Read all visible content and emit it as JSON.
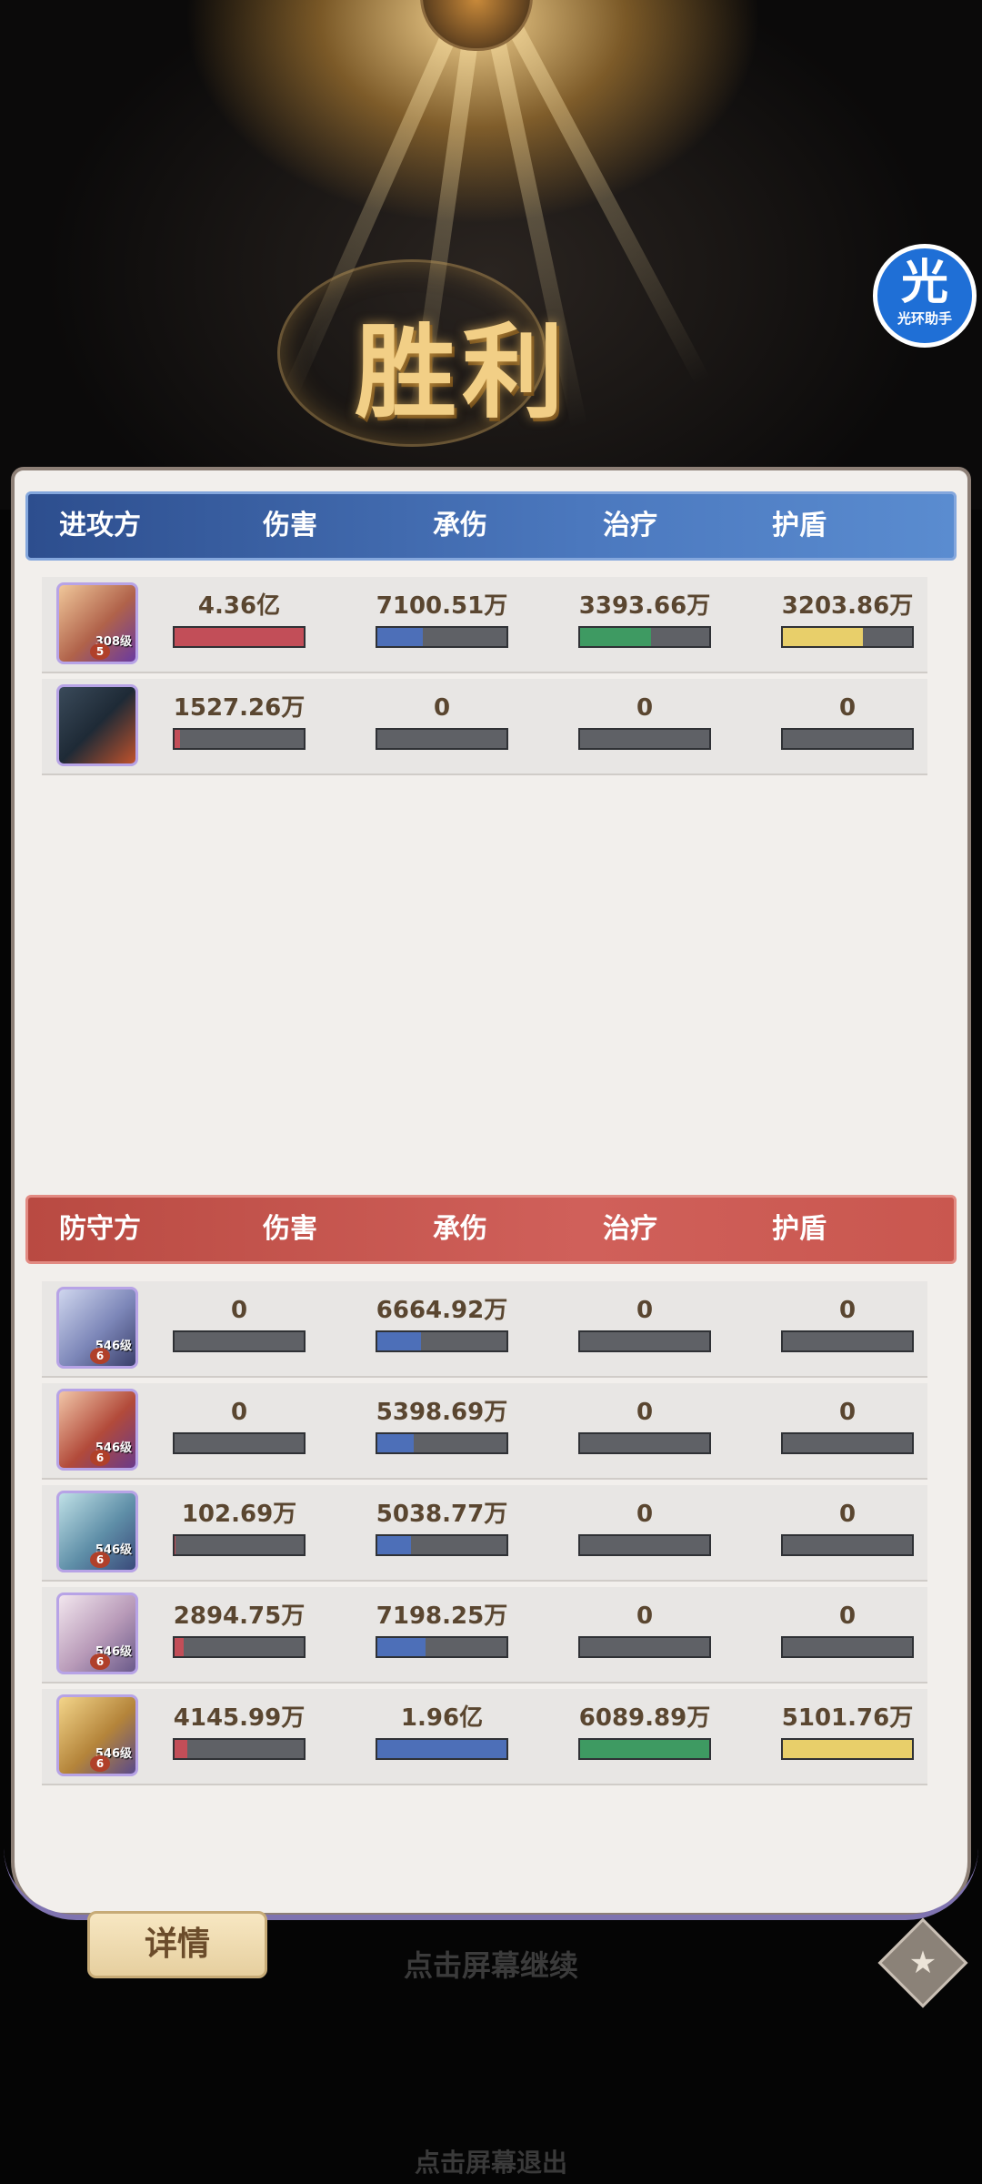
{
  "title_banner": "胜利",
  "helper_badge": {
    "glyph": "光",
    "label": "光环助手"
  },
  "columns": [
    "伤害",
    "承伤",
    "治疗",
    "护盾"
  ],
  "attackers": {
    "label": "进攻方",
    "rows": [
      {
        "level": "308级",
        "star": "5",
        "damage": "4.36亿",
        "taken": "7100.51万",
        "heal": "3393.66万",
        "shield": "3203.86万",
        "fill": {
          "damage": 1.0,
          "taken": 0.35,
          "heal": 0.55,
          "shield": 0.62
        }
      },
      {
        "level": "",
        "star": "",
        "damage": "1527.26万",
        "taken": "0",
        "heal": "0",
        "shield": "0",
        "fill": {
          "damage": 0.04,
          "taken": 0,
          "heal": 0,
          "shield": 0
        }
      }
    ]
  },
  "defenders": {
    "label": "防守方",
    "rows": [
      {
        "level": "546级",
        "star": "6",
        "damage": "0",
        "taken": "6664.92万",
        "heal": "0",
        "shield": "0",
        "fill": {
          "damage": 0,
          "taken": 0.34,
          "heal": 0,
          "shield": 0
        }
      },
      {
        "level": "546级",
        "star": "6",
        "damage": "0",
        "taken": "5398.69万",
        "heal": "0",
        "shield": "0",
        "fill": {
          "damage": 0,
          "taken": 0.28,
          "heal": 0,
          "shield": 0
        }
      },
      {
        "level": "546级",
        "star": "6",
        "damage": "102.69万",
        "taken": "5038.77万",
        "heal": "0",
        "shield": "0",
        "fill": {
          "damage": 0.01,
          "taken": 0.26,
          "heal": 0,
          "shield": 0
        }
      },
      {
        "level": "546级",
        "star": "6",
        "damage": "2894.75万",
        "taken": "7198.25万",
        "heal": "0",
        "shield": "0",
        "fill": {
          "damage": 0.07,
          "taken": 0.37,
          "heal": 0,
          "shield": 0
        }
      },
      {
        "level": "546级",
        "star": "6",
        "damage": "4145.99万",
        "taken": "1.96亿",
        "heal": "6089.89万",
        "shield": "5101.76万",
        "fill": {
          "damage": 0.1,
          "taken": 1.0,
          "heal": 1.0,
          "shield": 1.0
        }
      }
    ]
  },
  "detail_button": "详情",
  "tap_continue": "点击屏幕继续",
  "tap_exit": "点击屏幕退出"
}
